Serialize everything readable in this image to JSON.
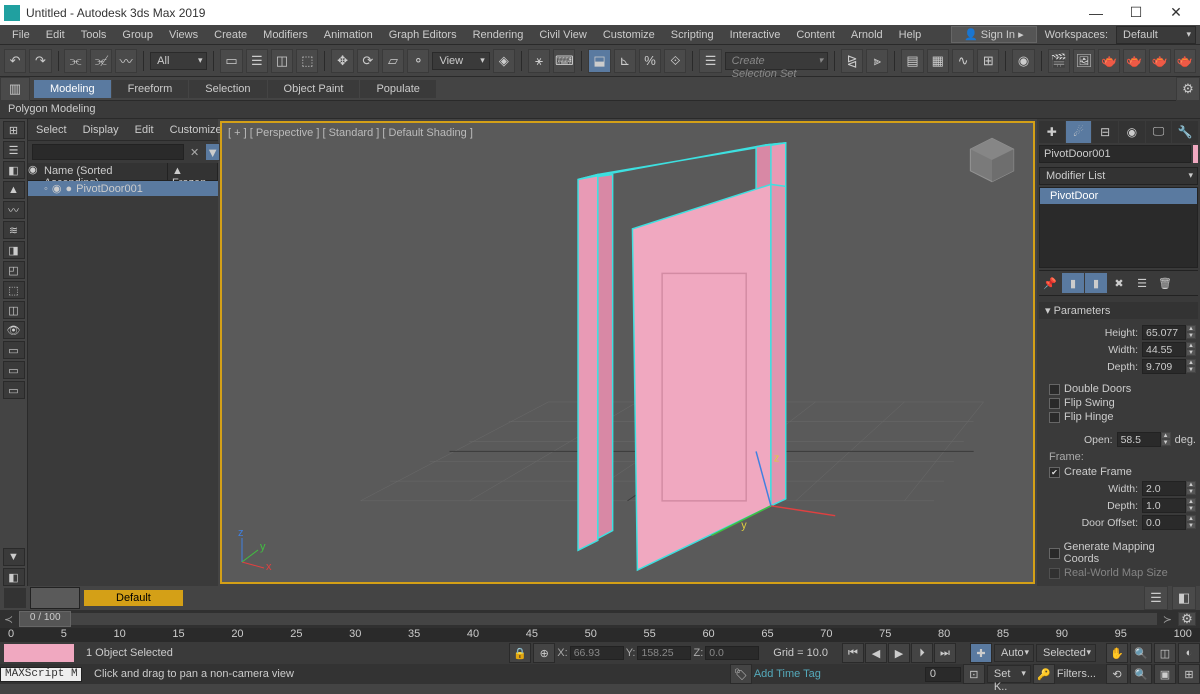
{
  "title": "Untitled - Autodesk 3ds Max 2019",
  "menu": [
    "File",
    "Edit",
    "Tools",
    "Group",
    "Views",
    "Create",
    "Modifiers",
    "Animation",
    "Graph Editors",
    "Rendering",
    "Civil View",
    "Customize",
    "Scripting",
    "Interactive",
    "Content",
    "Arnold",
    "Help"
  ],
  "signin": "Sign In",
  "workspace_label": "Workspaces:",
  "workspace_value": "Default",
  "ref_dropdown": "All",
  "view_dropdown": "View",
  "selset": "Create Selection Set",
  "ribbon_tabs": [
    "Modeling",
    "Freeform",
    "Selection",
    "Object Paint",
    "Populate"
  ],
  "ribbon_sub": "Polygon Modeling",
  "scene_tabs": [
    "Select",
    "Display",
    "Edit",
    "Customize"
  ],
  "scene_cols": {
    "name": "Name (Sorted Ascending)",
    "frozen": "▲ Frozen"
  },
  "scene_item": "PivotDoor001",
  "viewport_label": "[ + ] [ Perspective ] [ Standard ] [ Default Shading ]",
  "object_name": "PivotDoor001",
  "modifier_list_label": "Modifier List",
  "modifier_item": "PivotDoor",
  "params_header": "Parameters",
  "params": {
    "height_l": "Height:",
    "height_v": "65.077",
    "width_l": "Width:",
    "width_v": "44.55",
    "depth_l": "Depth:",
    "depth_v": "9.709",
    "double_doors": "Double Doors",
    "flip_swing": "Flip Swing",
    "flip_hinge": "Flip Hinge",
    "open_l": "Open:",
    "open_v": "58.5",
    "open_deg": "deg.",
    "frame_l": "Frame:",
    "create_frame": "Create Frame",
    "fwidth_l": "Width:",
    "fwidth_v": "2.0",
    "fdepth_l": "Depth:",
    "fdepth_v": "1.0",
    "offset_l": "Door Offset:",
    "offset_v": "0.0",
    "gen_map": "Generate Mapping Coords",
    "real_world": "Real-World Map Size"
  },
  "default_btn": "Default",
  "time": "0 / 100",
  "ruler": [
    "0",
    "5",
    "10",
    "15",
    "20",
    "25",
    "30",
    "35",
    "40",
    "45",
    "50",
    "55",
    "60",
    "65",
    "70",
    "75",
    "80",
    "85",
    "90",
    "95",
    "100"
  ],
  "status": {
    "sel": "1 Object Selected",
    "maxscript": "MAXScript Mi",
    "hint": "Click and drag to pan a non-camera view",
    "x": "X:",
    "xv": "66.93",
    "y": "Y:",
    "yv": "158.25",
    "z": "Z:",
    "zv": "0.0",
    "grid": "Grid = 10.0",
    "timetag": "Add Time Tag",
    "auto": "Auto",
    "setk": "Set K..",
    "selected": "Selected",
    "filters": "Filters..."
  }
}
